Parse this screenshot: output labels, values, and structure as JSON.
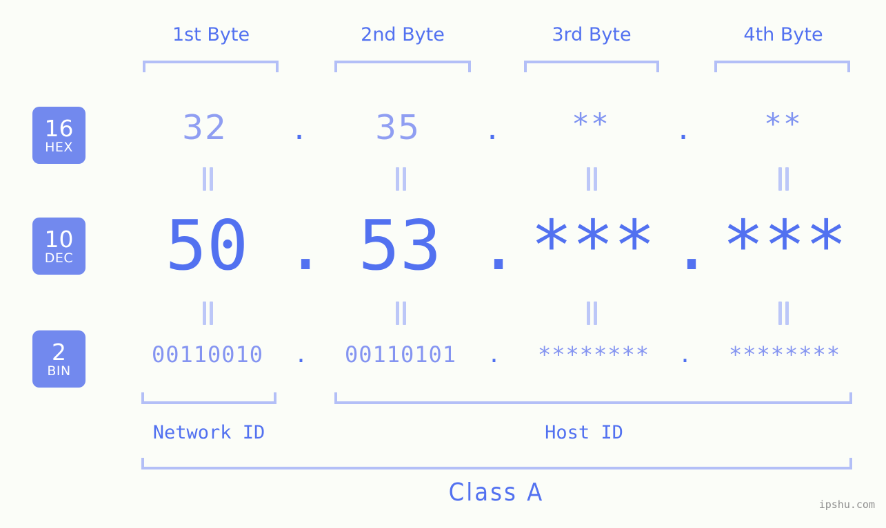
{
  "page": {
    "background_color": "#fbfdf8",
    "accent_color": "#5271f0",
    "accent_light_color": "#8f9ef2",
    "bracket_color": "#b3bff7",
    "badge_color": "#7289ee",
    "watermark": "ipshu.com"
  },
  "byte_headers": [
    {
      "label": "1st Byte"
    },
    {
      "label": "2nd Byte"
    },
    {
      "label": "3rd Byte"
    },
    {
      "label": "4th Byte"
    }
  ],
  "radix_badges": [
    {
      "number": "16",
      "name": "HEX"
    },
    {
      "number": "10",
      "name": "DEC"
    },
    {
      "number": "2",
      "name": "BIN"
    }
  ],
  "rows": {
    "hex": {
      "base": "16",
      "base_name": "HEX",
      "values": [
        "32",
        "35",
        "**",
        "**"
      ],
      "separator": "."
    },
    "dec": {
      "base": "10",
      "base_name": "DEC",
      "values": [
        "50",
        "53",
        "***",
        "***"
      ],
      "separator": "."
    },
    "bin": {
      "base": "2",
      "base_name": "BIN",
      "values": [
        "00110010",
        "00110101",
        "********",
        "********"
      ],
      "separator": "."
    }
  },
  "equals_marker": "||",
  "sections": [
    {
      "label": "Network ID"
    },
    {
      "label": "Host ID"
    }
  ],
  "class": {
    "label": "Class A"
  }
}
